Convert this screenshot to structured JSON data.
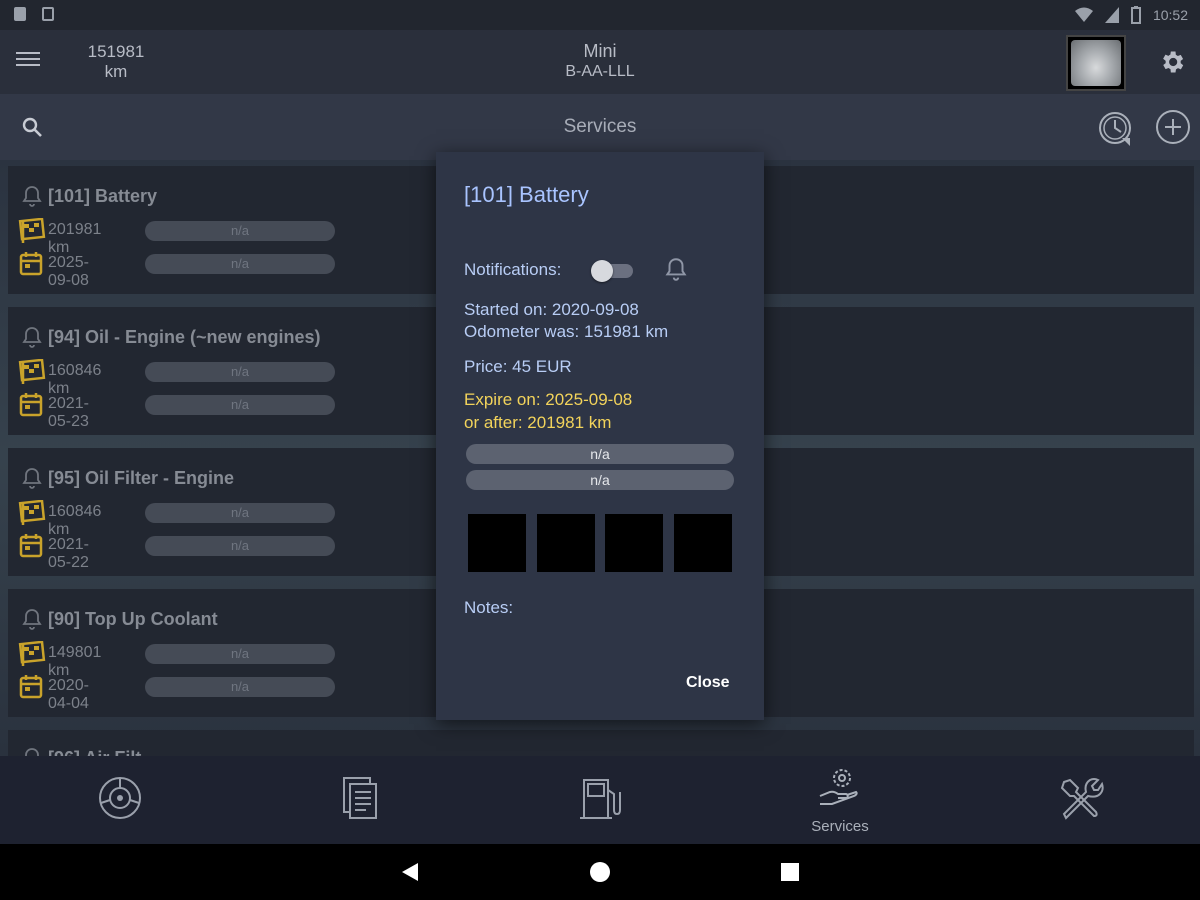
{
  "status_bar": {
    "time": "10:52"
  },
  "app_bar": {
    "odometer_value": "151981",
    "odometer_unit": "km",
    "car_name": "Mini",
    "car_plate": "B-AA-LLL"
  },
  "toolbar": {
    "title": "Services"
  },
  "services": [
    {
      "title": "[101] Battery",
      "km": "201981 km",
      "km_progress": "n/a",
      "date": "2025-09-08",
      "date_progress": "n/a"
    },
    {
      "title": "[94] Oil - Engine (~new engines)",
      "km": "160846 km",
      "km_progress": "n/a",
      "date": "2021-05-23",
      "date_progress": "n/a"
    },
    {
      "title": "[95] Oil Filter - Engine",
      "km": "160846 km",
      "km_progress": "n/a",
      "date": "2021-05-22",
      "date_progress": "n/a"
    },
    {
      "title": "[90] Top Up Coolant",
      "km": "149801 km",
      "km_progress": "n/a",
      "date": "2020-04-04",
      "date_progress": "n/a"
    },
    {
      "title": "[96] Air Filt"
    }
  ],
  "dialog": {
    "title": "[101] Battery",
    "notifications_label": "Notifications:",
    "notifications_enabled": false,
    "started_on": "Started on: 2020-09-08",
    "odometer_was": "Odometer was: 151981 km",
    "price": "Price: 45 EUR",
    "expire_on": "Expire on: 2025-09-08",
    "or_after": "or after: 201981 km",
    "progress_km": "n/a",
    "progress_date": "n/a",
    "notes_label": "Notes:",
    "close_label": "Close"
  },
  "bottom_nav": {
    "items": [
      {
        "icon": "dashboard-icon",
        "label": ""
      },
      {
        "icon": "documents-icon",
        "label": ""
      },
      {
        "icon": "fuel-icon",
        "label": ""
      },
      {
        "icon": "services-icon",
        "label": "Services"
      },
      {
        "icon": "tools-icon",
        "label": ""
      }
    ],
    "active_index": 3
  },
  "colors": {
    "accent_warning": "#f2d35b",
    "dialog_title": "#a9c4ff",
    "service_icon": "#c9a32b"
  }
}
